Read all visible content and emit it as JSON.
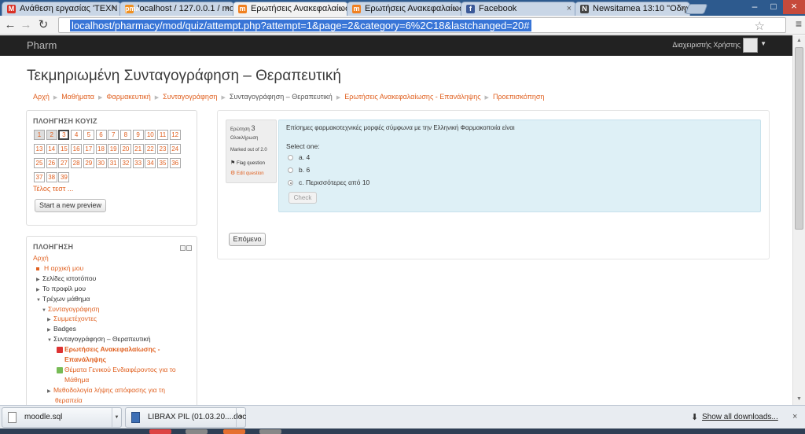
{
  "browser": {
    "tabs": [
      {
        "icon": "M",
        "title": "Ανάθεση εργασίας 'ΤΕΧΝ",
        "color": "#d93025"
      },
      {
        "icon": "pma",
        "title": "localhost / 127.0.0.1 / moo",
        "color": "#f09020"
      },
      {
        "icon": "m",
        "title": "Ερωτήσεις Ανακεφαλαίωσ",
        "color": "#f08020"
      },
      {
        "icon": "m",
        "title": "Ερωτήσεις Ανακεφαλαίωσ",
        "color": "#f08020"
      },
      {
        "icon": "f",
        "title": "Facebook",
        "color": "#3b5998"
      },
      {
        "icon": "N",
        "title": "Newsitamea 13:10 \"Οδηγ",
        "color": "#444444"
      }
    ],
    "tab_close": "×",
    "back": "←",
    "forward": "→",
    "reload": "↻",
    "url": "localhost/pharmacy/mod/quiz/attempt.php?attempt=1&page=2&category=6%2C18&lastchanged=20#",
    "star": "☆",
    "menu": "≡",
    "window_min": "–",
    "window_max": "□",
    "window_close": "×"
  },
  "topnav": {
    "brand": "Pharm",
    "user": "Διαχειριστής Χρήστης",
    "caret": "▼"
  },
  "header": {
    "title": "Τεκμηριωμένη Συνταγογράφηση – Θεραπευτική",
    "breadcrumb": [
      {
        "label": "Αρχή",
        "link": true
      },
      {
        "label": "Μαθήματα",
        "link": true
      },
      {
        "label": "Φαρμακευτική",
        "link": true
      },
      {
        "label": "Συνταγογράφηση",
        "link": true
      },
      {
        "label": "Συνταγογράφηση – Θεραπευτική",
        "link": false
      },
      {
        "label": "Ερωτήσεις Ανακεφαλαίωσης - Επανάληψης",
        "link": true
      },
      {
        "label": "Προεπισκόπηση",
        "link": true
      }
    ],
    "separator": "▶"
  },
  "quiz_nav": {
    "title": "ΠΛΟΗΓΗΣΗ ΚΟΥΙΖ",
    "questions": [
      "1",
      "2",
      "3",
      "4",
      "5",
      "6",
      "7",
      "8",
      "9",
      "10",
      "11",
      "12",
      "13",
      "14",
      "15",
      "16",
      "17",
      "18",
      "19",
      "20",
      "21",
      "22",
      "23",
      "24",
      "25",
      "26",
      "27",
      "28",
      "29",
      "30",
      "31",
      "32",
      "33",
      "34",
      "35",
      "36",
      "37",
      "38",
      "39"
    ],
    "answered": [
      "1",
      "2"
    ],
    "current": "3",
    "finish_link": "Τέλος τεστ ...",
    "preview_button": "Start a new preview"
  },
  "navigation": {
    "title": "ΠΛΟΗΓΗΣΗ",
    "items": [
      {
        "label": "Αρχή",
        "type": "link",
        "indent": 0,
        "marker": ""
      },
      {
        "label": "Η αρχική μου",
        "type": "link",
        "indent": 1,
        "marker": "bullet"
      },
      {
        "label": "Σελίδες ιστοτόπου",
        "type": "plain",
        "indent": 1,
        "marker": "▶"
      },
      {
        "label": "Το προφίλ μου",
        "type": "plain",
        "indent": 1,
        "marker": "▶"
      },
      {
        "label": "Τρέχων μάθημα",
        "type": "plain",
        "indent": 1,
        "marker": "▼"
      },
      {
        "label": "Συνταγογράφηση",
        "type": "link",
        "indent": 2,
        "marker": "▼"
      },
      {
        "label": "Συμμετέχοντες",
        "type": "link",
        "indent": 3,
        "marker": "▶"
      },
      {
        "label": "Badges",
        "type": "plain",
        "indent": 3,
        "marker": "▶"
      },
      {
        "label": "Συνταγογράφηση – Θεραπευτική",
        "type": "plain",
        "indent": 3,
        "marker": "▼"
      },
      {
        "label": "Ερωτήσεις Ανακεφαλαίωσης -",
        "type": "link-bold",
        "indent": 4,
        "marker": "quiz"
      },
      {
        "label": "Επανάληψης",
        "type": "link-bold",
        "indent": 4,
        "marker": ""
      },
      {
        "label": "Θέματα Γενικού Ενδιαφέροντος για το",
        "type": "link",
        "indent": 4,
        "marker": "forum"
      },
      {
        "label": "Μάθημα",
        "type": "link",
        "indent": 4,
        "marker": ""
      },
      {
        "label": "Μεθοδολογία λήψης απόφασης για τη",
        "type": "link",
        "indent": 3,
        "marker": "▶"
      },
      {
        "label": "θεραπεία",
        "type": "link",
        "indent": 3,
        "marker": ""
      }
    ]
  },
  "question": {
    "label": "Ερώτηση",
    "number": "3",
    "status": "Ολοκλήρωση",
    "marks": "Marked out of 2.0",
    "flag": "Flag question",
    "edit": "Edit question",
    "text": "Επίσημες φαρμακοτεχνικές μορφές  σύμφωνα με την Ελληνική Φαρμακοποιία είναι",
    "prompt": "Select one:",
    "options": [
      {
        "label": "a. 4",
        "selected": false
      },
      {
        "label": "b. 6",
        "selected": false
      },
      {
        "label": "c. Περισσότερες από 10",
        "selected": true
      }
    ],
    "check_button": "Check",
    "next_button": "Επόμενο"
  },
  "downloads": {
    "items": [
      "moodle.sql",
      "LIBRAX PIL (01.03.20....doc"
    ],
    "show_all": "Show all downloads...",
    "close": "×",
    "show_all_icon": "⬇"
  }
}
